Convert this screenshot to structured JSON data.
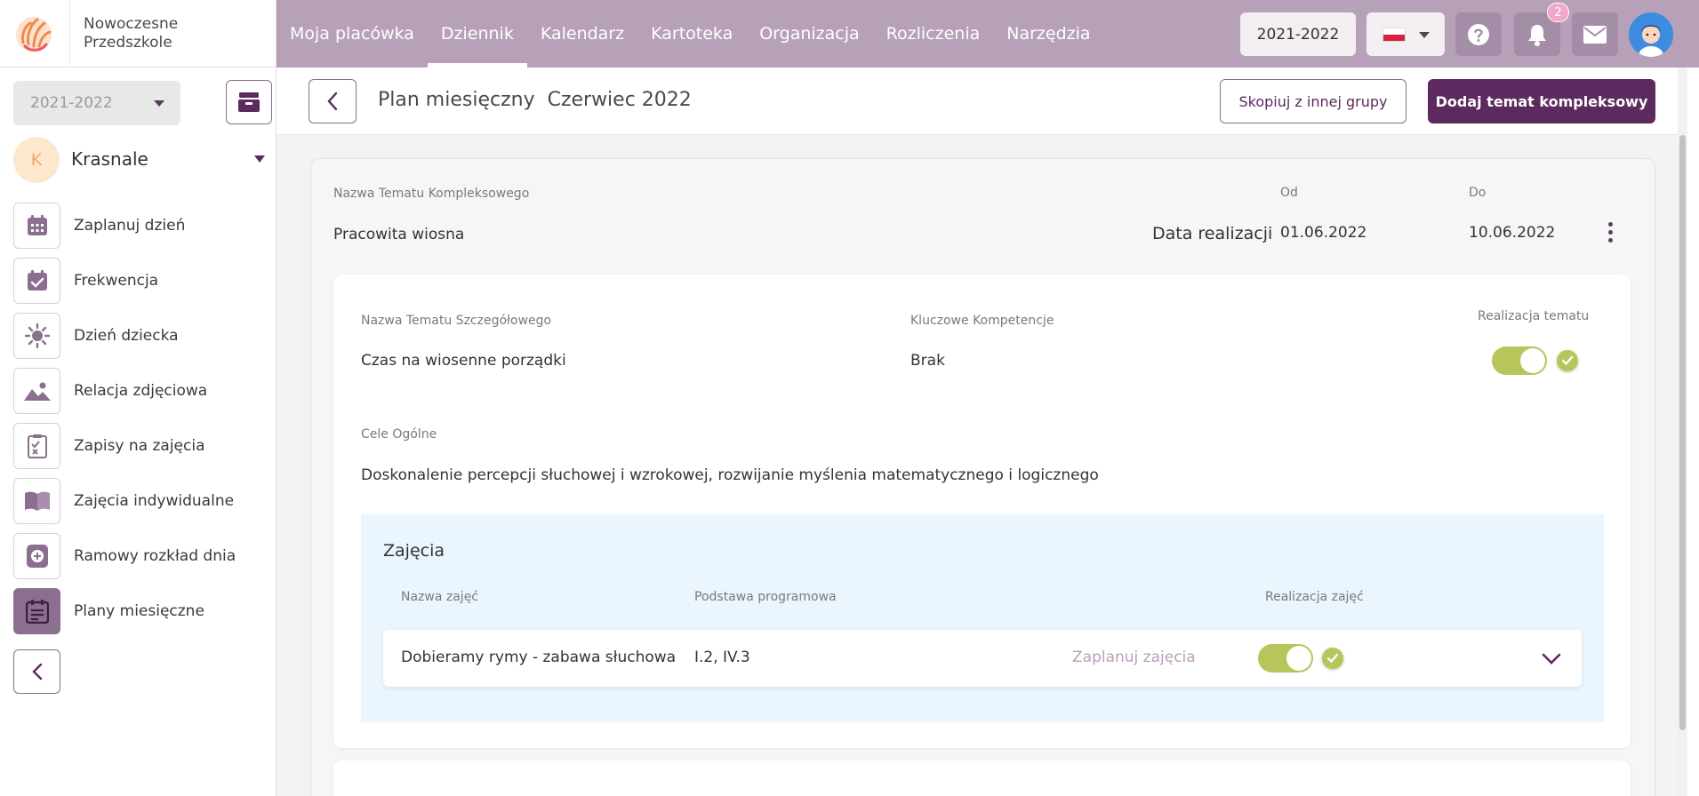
{
  "app": {
    "name_line1": "Nowoczesne",
    "name_line2": "Przedszkole"
  },
  "nav": {
    "items": [
      {
        "label": "Moja placówka"
      },
      {
        "label": "Dziennik",
        "active": true
      },
      {
        "label": "Kalendarz"
      },
      {
        "label": "Kartoteka"
      },
      {
        "label": "Organizacja"
      },
      {
        "label": "Rozliczenia"
      },
      {
        "label": "Narzędzia"
      }
    ]
  },
  "header": {
    "year": "2021-2022",
    "language_icon": "poland-flag-icon",
    "help_icon": "question-circle-icon",
    "notifications_icon": "bell-icon",
    "notifications_count": "2",
    "messages_icon": "envelope-icon",
    "avatar": "user-avatar"
  },
  "sidebar": {
    "year": "2021-2022",
    "archive_icon": "archive-icon",
    "group_initial": "K",
    "group_name": "Krasnale",
    "items": [
      {
        "label": "Zaplanuj dzień",
        "icon": "calendar-grid-icon"
      },
      {
        "label": "Frekwencja",
        "icon": "calendar-check-icon"
      },
      {
        "label": "Dzień dziecka",
        "icon": "sun-icon"
      },
      {
        "label": "Relacja zdjęciowa",
        "icon": "image-icon"
      },
      {
        "label": "Zapisy na zajęcia",
        "icon": "clipboard-checklist-icon"
      },
      {
        "label": "Zajęcia indywidualne",
        "icon": "open-book-icon"
      },
      {
        "label": "Ramowy rozkład dnia",
        "icon": "clock-plus-icon"
      },
      {
        "label": "Plany miesięczne",
        "icon": "calendar-list-icon",
        "active": true
      }
    ],
    "collapse_icon": "chevron-left-icon"
  },
  "page": {
    "title": "Plan miesięczny  Czerwiec 2022",
    "copy_button": "Skopiuj z innej grupy",
    "add_button": "Dodaj temat kompleksowy"
  },
  "complex_topic": {
    "name_label": "Nazwa Tematu Kompleksowego",
    "name": "Pracowita wiosna",
    "date_label": "Data realizacji",
    "from_label": "Od",
    "from": "01.06.2022",
    "to_label": "Do",
    "to": "10.06.2022"
  },
  "detail_topic": {
    "name_label": "Nazwa Tematu Szczegółowego",
    "name": "Czas na wiosenne porządki",
    "competences_label": "Kluczowe Kompetencje",
    "competences": "Brak",
    "realization_label": "Realizacja tematu",
    "realized": true,
    "goals_label": "Cele Ogólne",
    "goals": "Doskonalenie percepcji słuchowej i wzrokowej, rozwijanie myślenia matematycznego i logicznego"
  },
  "activities": {
    "title": "Zajęcia",
    "col_name": "Nazwa zajęć",
    "col_basis": "Podstawa programowa",
    "col_realization": "Realizacja zajęć",
    "rows": [
      {
        "name": "Dobieramy rymy - zabawa słuchowa",
        "basis": "I.2, IV.3",
        "plan_link": "Zaplanuj zajęcia",
        "realized": true
      }
    ]
  },
  "colors": {
    "brand": "#5d2a5f",
    "topbar": "#b7a1b9",
    "toggle_on": "#b7c55a",
    "activities_bg": "#eaf5fd"
  }
}
